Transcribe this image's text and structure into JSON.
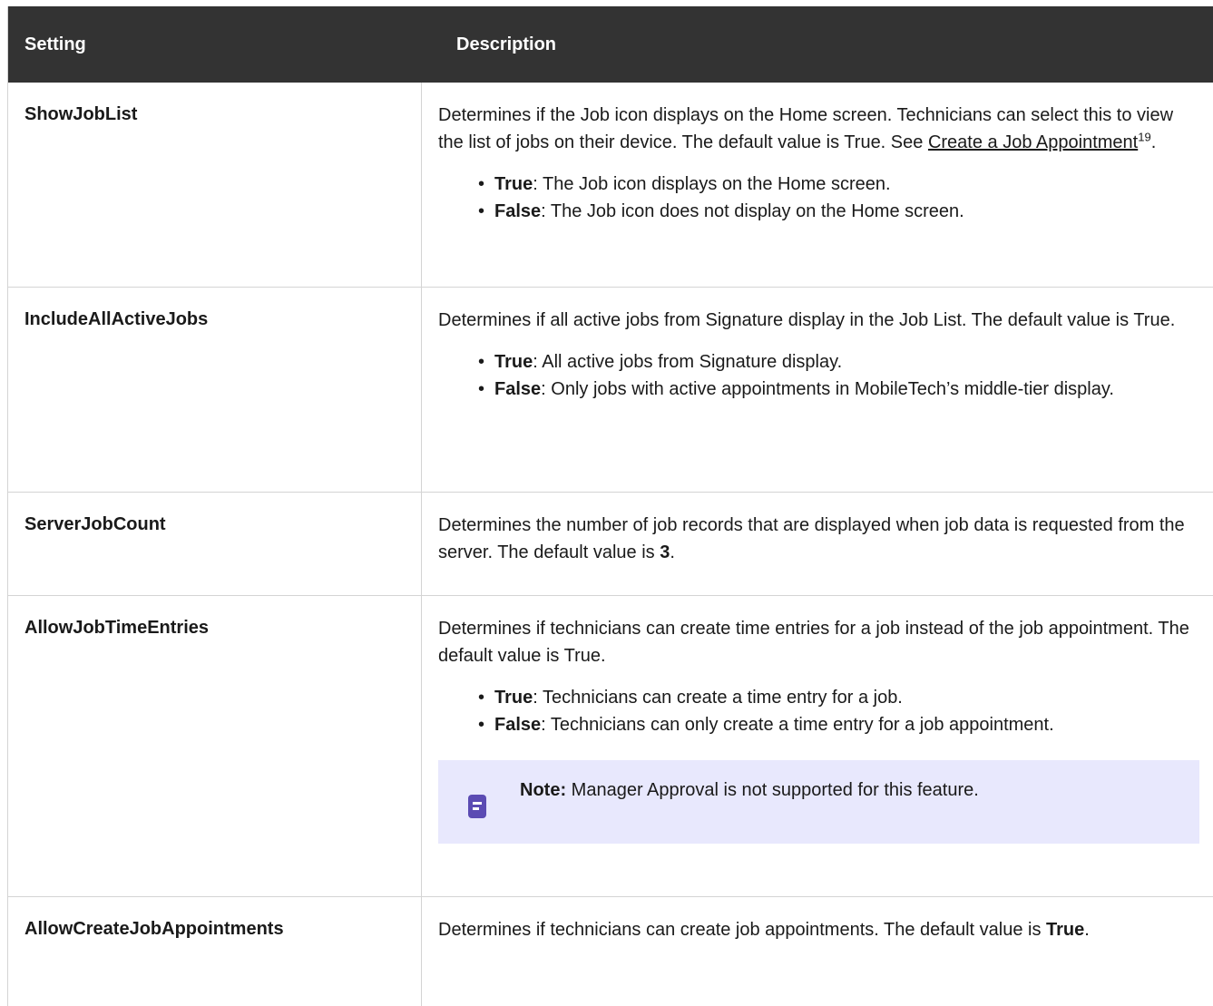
{
  "header": {
    "setting": "Setting",
    "description": "Description"
  },
  "rows": [
    {
      "setting": "ShowJobList",
      "desc": "Determines if the Job icon displays on the Home screen. Technicians can select this to view the list of jobs on their device. The default value is True. See ",
      "link": "Create a Job Appointment",
      "sup": "19",
      "after": ".",
      "bullets": [
        {
          "k": "True",
          "v": ": The Job icon displays on the Home screen."
        },
        {
          "k": "False",
          "v": ": The Job icon does not display on the Home screen."
        }
      ]
    },
    {
      "setting": "IncludeAllActiveJobs",
      "desc": "Determines if all active jobs from Signature display in the Job List. The default value is True.",
      "bullets": [
        {
          "k": "True",
          "v": ": All active jobs from Signature display."
        },
        {
          "k": "False",
          "v": ": Only jobs with active appointments in MobileTech’s middle-tier display."
        }
      ]
    },
    {
      "setting": "ServerJobCount",
      "desc": "Determines the number of job records that are displayed when job data is requested from the server. The default value is ",
      "bold_value": "3",
      "after": "."
    },
    {
      "setting": "AllowJobTimeEntries",
      "desc": "Determines if technicians can create time entries for a job instead of the job appointment. The default value is True.",
      "bullets": [
        {
          "k": "True",
          "v": ": Technicians can create a time entry for a job."
        },
        {
          "k": "False",
          "v": ": Technicians can only create a time entry for a job appointment."
        }
      ],
      "note": {
        "label": "Note:",
        "text": " Manager Approval is not supported for this feature.",
        "icon": "note-icon"
      }
    },
    {
      "setting": "AllowCreateJobAppointments",
      "desc": "Determines if technicians can create job appointments. The default value is ",
      "bold_value": "True",
      "after": "."
    }
  ]
}
